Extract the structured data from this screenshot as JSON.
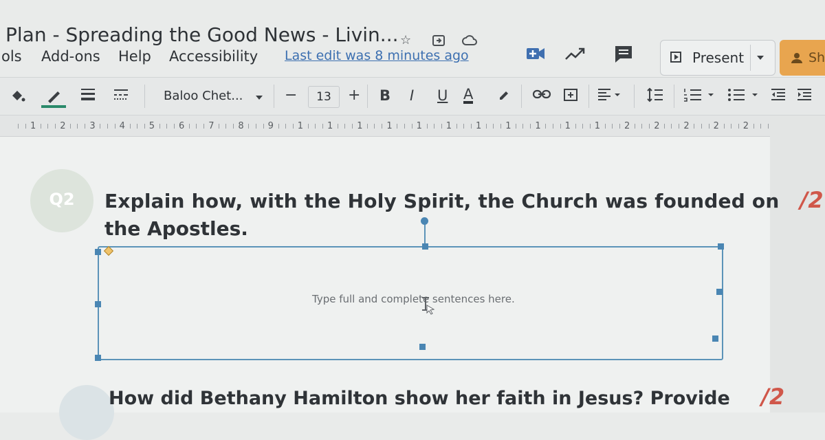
{
  "header": {
    "title": "Plan - Spreading the Good News - Livin...",
    "last_edit": "Last edit was 8 minutes ago"
  },
  "menu": {
    "items": [
      "ols",
      "Add-ons",
      "Help",
      "Accessibility"
    ]
  },
  "actions": {
    "present_label": "Present",
    "share_label": "Sh"
  },
  "toolbar": {
    "font_name": "Baloo Chet...",
    "font_size": "13",
    "minus": "−",
    "plus": "+",
    "bold": "B",
    "italic": "I",
    "underline": "U",
    "text_color": "A"
  },
  "ruler": {
    "labels": [
      "1",
      "2",
      "3",
      "4",
      "5",
      "6",
      "7",
      "8",
      "9",
      "1",
      "1",
      "1",
      "1",
      "1",
      "1",
      "1",
      "1",
      "1",
      "1",
      "1",
      "2",
      "2",
      "2",
      "2",
      "2",
      "2"
    ]
  },
  "question": {
    "number": "Q2",
    "line1": "Explain how, with the Holy Spirit, the Church was founded on",
    "line2": "the Apostles.",
    "score": "/2"
  },
  "answer": {
    "placeholder": "Type full and complete sentences here."
  },
  "next_question": {
    "text": "How did Bethany Hamilton show her faith in Jesus? Provide",
    "score": "/2"
  },
  "colors": {
    "accent": "#4a86b3",
    "score": "#d0574a",
    "share": "#e8a54f"
  }
}
